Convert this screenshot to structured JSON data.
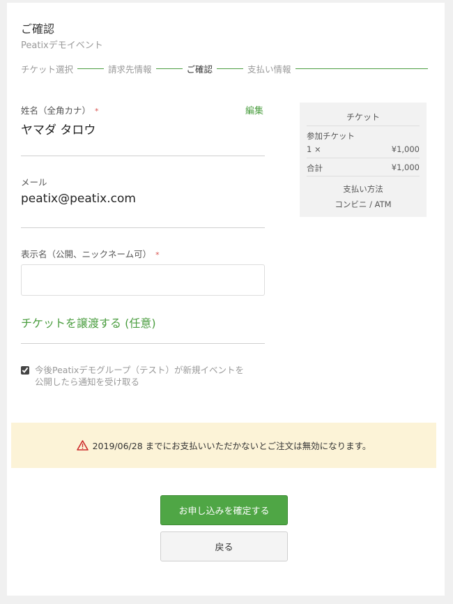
{
  "header": {
    "title": "ご確認",
    "event_name": "Peatixデモイベント"
  },
  "steps": [
    {
      "label": "チケット選択",
      "current": false
    },
    {
      "label": "請求先情報",
      "current": false
    },
    {
      "label": "ご確認",
      "current": true
    },
    {
      "label": "支払い情報",
      "current": false
    }
  ],
  "form": {
    "name_label": "姓名（全角カナ）",
    "required_mark": "*",
    "edit_label": "編集",
    "name_value": "ヤマダ タロウ",
    "email_label": "メール",
    "email_value": "peatix@peatix.com",
    "display_name_label": "表示名（公開、ニックネーム可）",
    "display_name_value": "",
    "display_name_placeholder": "",
    "transfer_link": "チケットを譲渡する (任意)",
    "notify_checked": true,
    "notify_text_line1": "今後Peatixデモグループ（テスト）が新規イベントを",
    "notify_text_line2": "公開したら通知を受け取る"
  },
  "summary": {
    "title": "チケット",
    "ticket_type": "参加チケット",
    "ticket_qty": "1 ×",
    "ticket_price": "¥1,000",
    "total_label": "合計",
    "total_value": "¥1,000",
    "payment_method_label": "支払い方法",
    "payment_method_value": "コンビニ / ATM"
  },
  "warning": {
    "text": "2019/06/28 までにお支払いいただかないとご注文は無効になります。"
  },
  "buttons": {
    "confirm": "お申し込みを確定する",
    "back": "戻る"
  },
  "colors": {
    "accent_green": "#4fa645",
    "link_green": "#4a9d3f",
    "required_red": "#d9534f",
    "warning_bg": "#fcf3d7",
    "warning_icon": "#cc2b2b"
  }
}
